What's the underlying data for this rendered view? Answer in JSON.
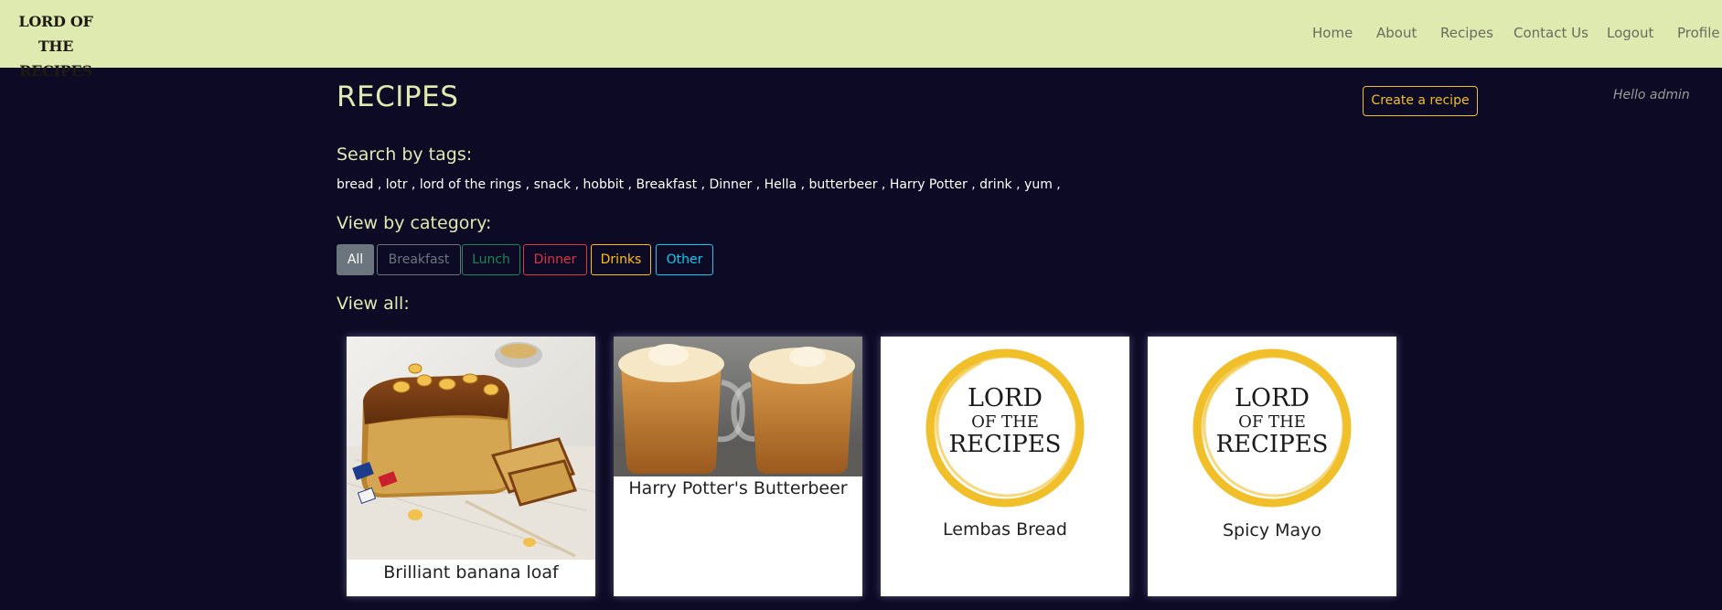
{
  "nav": {
    "brand_line1": "LORD OF THE",
    "brand_line2": "RECIPES",
    "links": [
      "Home",
      "About",
      "Recipes",
      "Contact Us",
      "Logout",
      "Profile"
    ]
  },
  "page": {
    "title": "RECIPES",
    "create_button": "Create a recipe",
    "greeting": "Hello admin"
  },
  "tags_section": {
    "heading": "Search by tags:",
    "tags": [
      "bread",
      "lotr",
      "lord of the rings",
      "snack",
      "hobbit",
      "Breakfast",
      "Dinner",
      "Hella",
      "butterbeer",
      "Harry Potter",
      "drink",
      "yum"
    ],
    "separator": " , "
  },
  "category_section": {
    "heading": "View by category:",
    "categories": [
      {
        "label": "All",
        "color": "#ffffff",
        "active": true
      },
      {
        "label": "Breakfast",
        "color": "#6c757d",
        "active": false
      },
      {
        "label": "Lunch",
        "color": "#198754",
        "active": false
      },
      {
        "label": "Dinner",
        "color": "#dc3545",
        "active": false
      },
      {
        "label": "Drinks",
        "color": "#ffc107",
        "active": false
      },
      {
        "label": "Other",
        "color": "#0dcaf0",
        "active": false
      }
    ]
  },
  "view_all": {
    "heading": "View all:"
  },
  "recipes": [
    {
      "title": "Brilliant banana loaf",
      "image": "banana-loaf-photo"
    },
    {
      "title": "Harry Potter's Butterbeer",
      "image": "butterbeer-photo"
    },
    {
      "title": "Lembas Bread",
      "image": "site-logo"
    },
    {
      "title": "Spicy Mayo",
      "image": "site-logo"
    }
  ],
  "logo": {
    "line1": "LORD",
    "line2": "OF THE",
    "line3": "RECIPES",
    "ring_color": "#f0bf2a"
  },
  "colors": {
    "background": "#0c0a25",
    "navbar": "#deeab0",
    "heading": "#deeab0",
    "accent": "#f0bf2a"
  }
}
